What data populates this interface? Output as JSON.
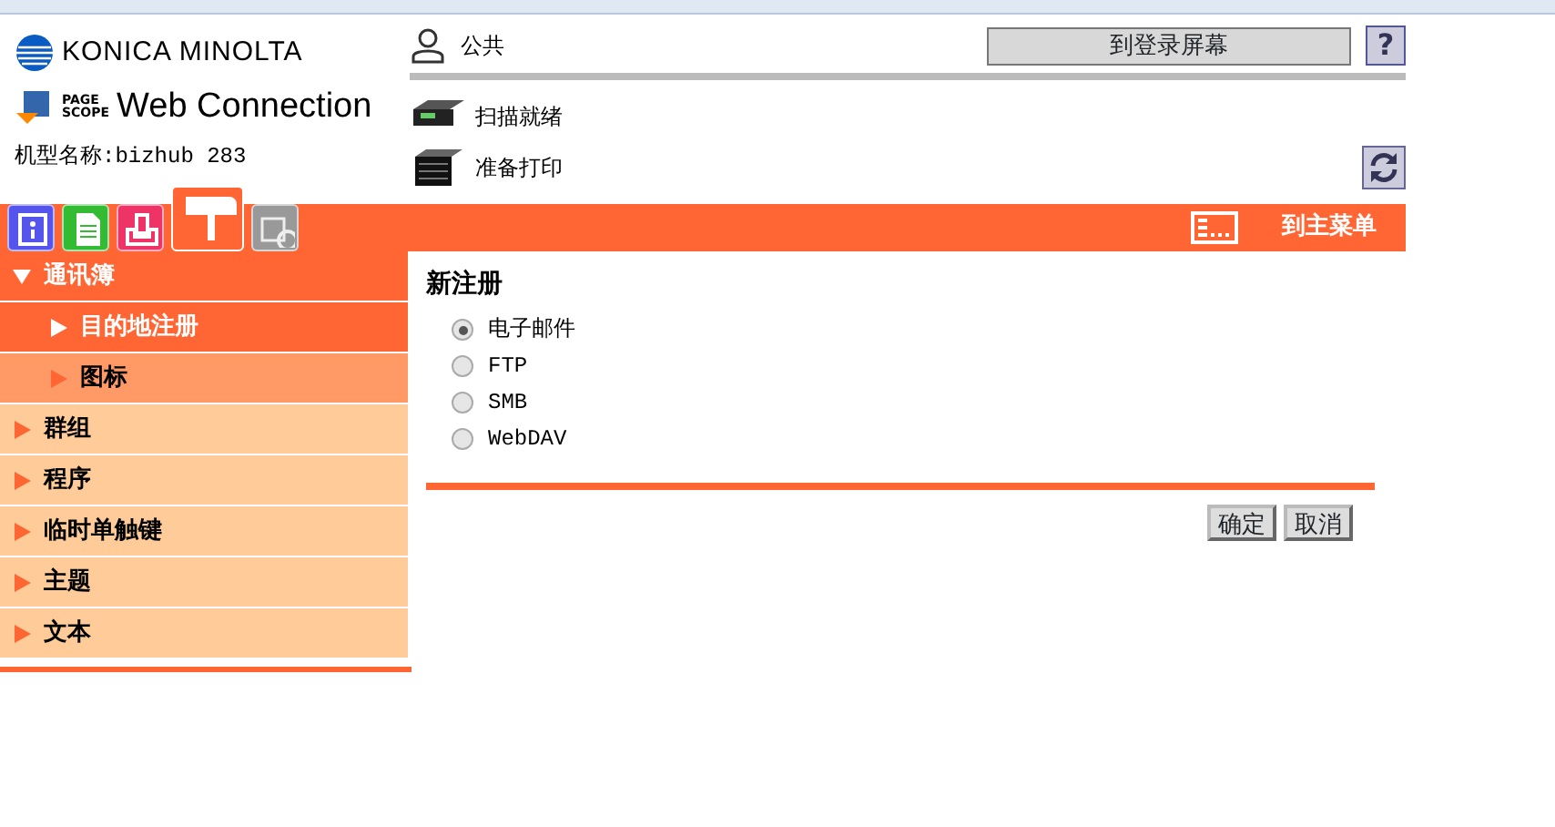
{
  "logo": {
    "brand": "KONICA MINOLTA",
    "product_small": [
      "PAGE",
      "SCOPE"
    ],
    "product": "Web Connection"
  },
  "model_label": "机型名称:bizhub 283",
  "user_label": "公共",
  "login_button": "到登录屏幕",
  "help_button": "?",
  "status": [
    {
      "kind": "scanner",
      "text": "扫描就绪"
    },
    {
      "kind": "printer",
      "text": "准备打印"
    }
  ],
  "function_tabs": [
    {
      "kind": "info",
      "selected": false
    },
    {
      "kind": "job",
      "selected": false
    },
    {
      "kind": "box",
      "selected": false
    },
    {
      "kind": "addressbook",
      "selected": true
    },
    {
      "kind": "settings",
      "selected": false
    }
  ],
  "main_menu": "到主菜单",
  "sidebar": [
    {
      "label": "通讯簿",
      "expanded": true,
      "children": [
        {
          "label": "目的地注册",
          "selected": true
        },
        {
          "label": "图标",
          "selected": false
        }
      ]
    },
    {
      "label": "群组",
      "expanded": false
    },
    {
      "label": "程序",
      "expanded": false
    },
    {
      "label": "临时单触键",
      "expanded": false
    },
    {
      "label": "主题",
      "expanded": false
    },
    {
      "label": "文本",
      "expanded": false
    }
  ],
  "form": {
    "title": "新注册",
    "options": [
      {
        "label": "电子邮件",
        "selected": true
      },
      {
        "label": "FTP",
        "selected": false
      },
      {
        "label": "SMB",
        "selected": false
      },
      {
        "label": "WebDAV",
        "selected": false
      }
    ],
    "buttons": [
      "确定",
      "取消"
    ]
  }
}
